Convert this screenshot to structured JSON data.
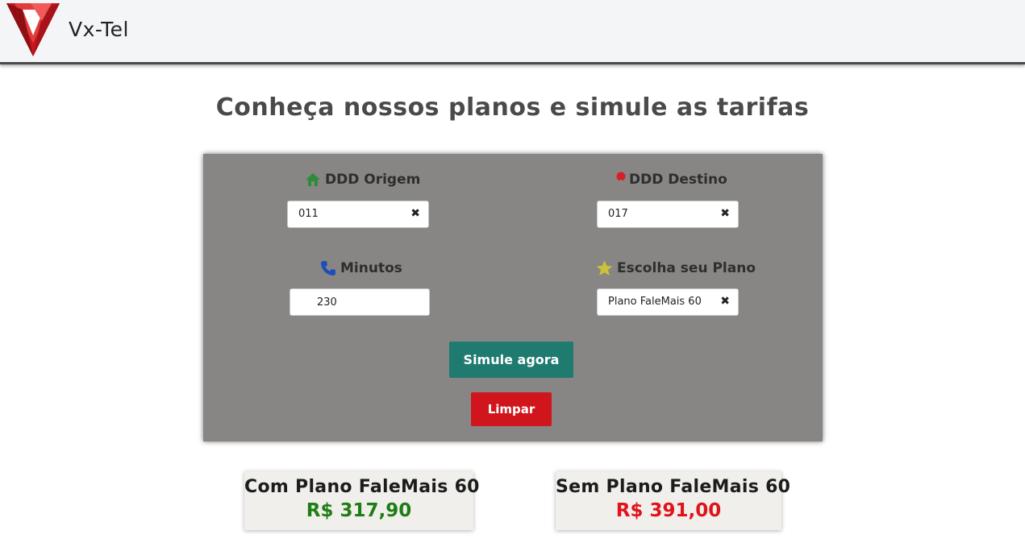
{
  "header": {
    "brand": "Vx-Tel",
    "logo_icon": "vx-tel-v-logo-icon",
    "logo_colors": [
      "#c4161c",
      "#8e0f14",
      "#e23b3b"
    ]
  },
  "page_title": "Conheça nossos planos e simule as tarifas",
  "form": {
    "origin": {
      "label": "DDD Origem",
      "icon": "home-icon",
      "icon_color": "#2e8b3a",
      "value": "011"
    },
    "destination": {
      "label": "DDD Destino",
      "icon": "map-pin-icon",
      "icon_color": "#d61f26",
      "value": "017"
    },
    "minutes": {
      "label": "Minutos",
      "icon": "phone-icon",
      "icon_color": "#1d4fb8",
      "value": "230"
    },
    "plan": {
      "label": "Escolha seu Plano",
      "icon": "star-icon",
      "icon_color": "#c9c23a",
      "value": "Plano FaleMais 60"
    },
    "clear_glyph": "✖",
    "simulate_label": "Simule agora",
    "reset_label": "Limpar"
  },
  "results": {
    "with_plan": {
      "title": "Com Plano FaleMais 60",
      "value": "R$ 317,90",
      "color": "#1e7d14"
    },
    "without_plan": {
      "title": "Sem Plano FaleMais 60",
      "value": "R$ 391,00",
      "color": "#e0131b"
    }
  },
  "colors": {
    "panel_bg": "#878684",
    "simulate_button": "#1f7a70",
    "clear_button": "#d0151d"
  }
}
